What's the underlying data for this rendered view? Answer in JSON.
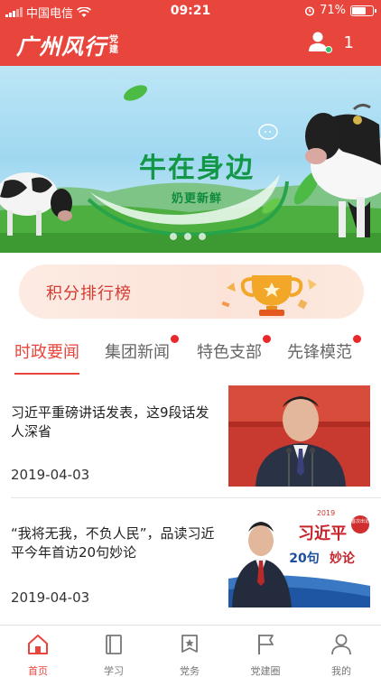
{
  "status_bar": {
    "carrier": "中国电信",
    "time": "09:21",
    "battery": "71%",
    "battery_level": 0.71
  },
  "app": {
    "logo_main": "广州风行",
    "logo_sub": "党建",
    "user_count": "1"
  },
  "banner": {
    "title": "牛在身边",
    "subtitle": "奶更新鲜",
    "slide_count": 3
  },
  "points": {
    "label": "积分排行榜"
  },
  "tabs": [
    {
      "label": "时政要闻",
      "active": true,
      "badge": false
    },
    {
      "label": "集团新闻",
      "active": false,
      "badge": true
    },
    {
      "label": "特色支部",
      "active": false,
      "badge": true
    },
    {
      "label": "先锋模范",
      "active": false,
      "badge": true
    }
  ],
  "news": [
    {
      "title": "习近平重磅讲话发表，这9段话发人深省",
      "date": "2019-04-03"
    },
    {
      "title": "“我将无我，不负人民”，品读习近平今年首访20句妙论",
      "date": "2019-04-03",
      "thumb_text": {
        "name": "习近平",
        "tag": "首次出访",
        "count": "20句",
        "word": "妙论",
        "year": "2019"
      }
    }
  ],
  "bottom_nav": [
    {
      "label": "首页",
      "icon": "home-icon",
      "active": true
    },
    {
      "label": "学习",
      "icon": "book-icon",
      "active": false
    },
    {
      "label": "党务",
      "icon": "badge-icon",
      "active": false
    },
    {
      "label": "党建圈",
      "icon": "flag-icon",
      "active": false
    },
    {
      "label": "我的",
      "icon": "user-icon",
      "active": false
    }
  ],
  "colors": {
    "brand_red": "#e8453c",
    "green": "#119745"
  }
}
